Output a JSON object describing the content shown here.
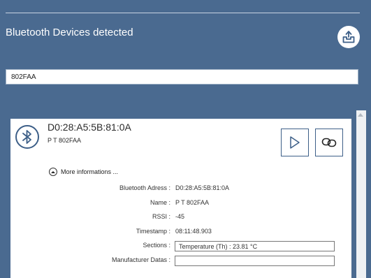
{
  "header": {
    "title": "Bluetooth Devices detected",
    "export_icon": "export-tray-icon"
  },
  "search": {
    "value": "802FAA"
  },
  "device": {
    "address": "D0:28:A5:5B:81:0A",
    "name": "P T 802FAA",
    "icon": "bluetooth-icon",
    "play_icon": "play-icon",
    "link_icon": "link-icon",
    "more_label": "More informations ...",
    "details": {
      "address_label": "Bluetooth Adress :",
      "address_value": "D0:28:A5:5B:81:0A",
      "name_label": "Name :",
      "name_value": "P T 802FAA",
      "rssi_label": "RSSI :",
      "rssi_value": "-45",
      "timestamp_label": "Timestamp :",
      "timestamp_value": "08:11:48.903",
      "sections_label": "Sections :",
      "sections_value": "Temperature (Th) : 23.81 °C",
      "manufacturer_label": "Manufacturer Datas :",
      "manufacturer_value": ""
    }
  },
  "colors": {
    "background": "#4a6a90",
    "accent": "#3d5f88",
    "card": "#ffffff"
  }
}
